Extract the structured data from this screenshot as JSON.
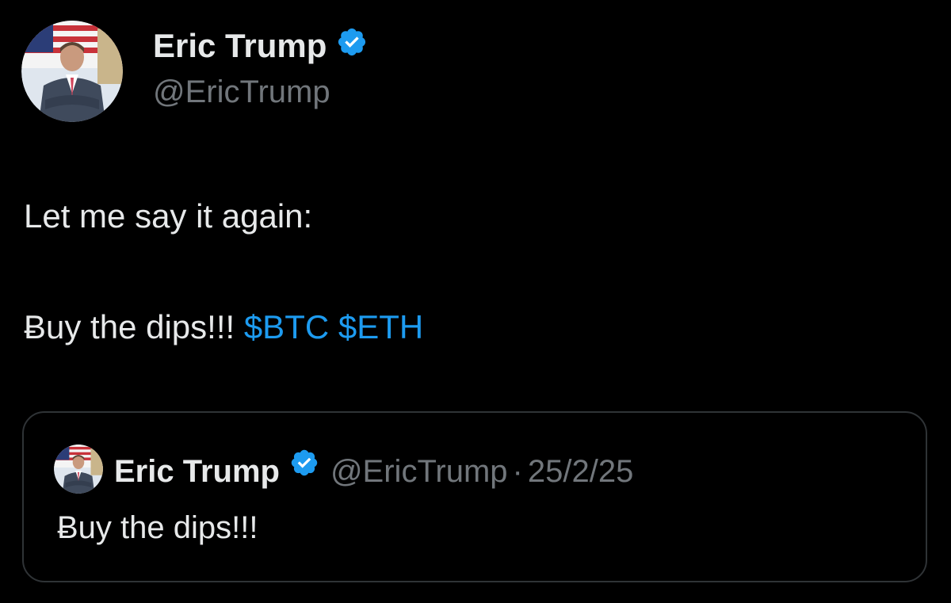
{
  "tweet": {
    "author": {
      "name": "Eric Trump",
      "handle": "@EricTrump",
      "verified": true
    },
    "text_line_1": "Let me say it again:",
    "text_line_2_prefix": "Ƀuy the dips!!!",
    "cashtags": [
      "$BTC",
      "$ETH"
    ],
    "quoted": {
      "name": "Eric Trump",
      "handle": "@EricTrump",
      "separator": "·",
      "date": "25/2/25",
      "text": "Ƀuy the dips!!!"
    }
  },
  "colors": {
    "background": "#000000",
    "text": "#e7e9ea",
    "muted": "#71767b",
    "link": "#1d9bf0",
    "verified": "#1d9bf0",
    "border": "#2f3336"
  },
  "icons": {
    "avatar": "profile-photo",
    "verified": "verified-badge-icon"
  }
}
